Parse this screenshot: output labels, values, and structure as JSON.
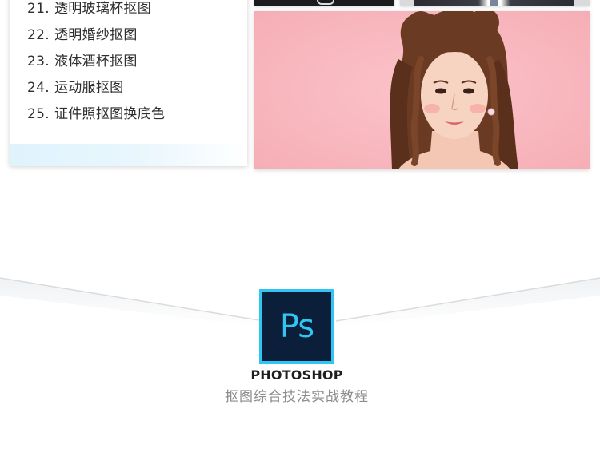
{
  "course_list": {
    "items": [
      {
        "num": "21.",
        "label": "透明玻璃杯抠图"
      },
      {
        "num": "22.",
        "label": "透明婚纱抠图"
      },
      {
        "num": "23.",
        "label": "液体酒杯抠图"
      },
      {
        "num": "24.",
        "label": "运动服抠图"
      },
      {
        "num": "25.",
        "label": "证件照抠图换底色"
      }
    ]
  },
  "logo": {
    "text": "Ps",
    "brand": "PHOTOSHOP",
    "subtitle": "抠图综合技法实战教程"
  },
  "colors": {
    "photo_background": "#f9b9c0",
    "logo_border": "#31c5f4",
    "logo_background": "#0c1f3a"
  }
}
